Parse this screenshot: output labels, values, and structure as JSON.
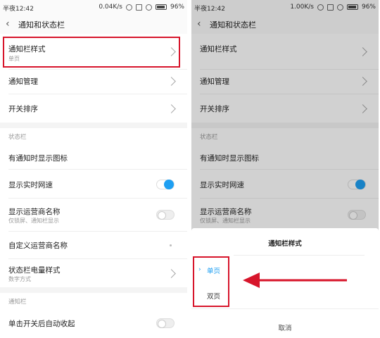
{
  "left": {
    "status": {
      "time": "半夜12:42",
      "speed": "0.04K/s",
      "battery": "96%"
    },
    "title": "通知和状态栏",
    "rows": {
      "notif_style": {
        "label": "通知栏样式",
        "sub": "单页"
      },
      "notif_manage": {
        "label": "通知管理"
      },
      "switch_order": {
        "label": "开关排序"
      },
      "statusbar_header": "状态栏",
      "show_icon": {
        "label": "有通知时显示图标"
      },
      "realtime_speed": {
        "label": "显示实时网速",
        "state": "on"
      },
      "carrier_name": {
        "label": "显示运营商名称",
        "sub": "仅锁屏、通知栏显示",
        "state": "off"
      },
      "custom_carrier": {
        "label": "自定义运营商名称"
      },
      "battery_style": {
        "label": "状态栏电量样式",
        "sub": "数字方式"
      },
      "notifbar_header": "通知栏",
      "auto_collapse": {
        "label": "单击开关后自动收起",
        "state": "off"
      }
    }
  },
  "right": {
    "status": {
      "time": "半夜12:42",
      "speed": "1.00K/s",
      "battery": "96%"
    },
    "title": "通知和状态栏",
    "rows": {
      "notif_style": {
        "label": "通知栏样式"
      },
      "notif_manage": {
        "label": "通知管理"
      },
      "switch_order": {
        "label": "开关排序"
      },
      "statusbar_header": "状态栏",
      "show_icon": {
        "label": "有通知时显示图标"
      },
      "realtime_speed": {
        "label": "显示实时网速"
      },
      "carrier_name": {
        "label": "显示运营商名称",
        "sub": "仅锁屏、通知栏显示"
      }
    },
    "sheet": {
      "title": "通知栏样式",
      "options": [
        "单页",
        "双页"
      ],
      "selected": "单页",
      "cancel": "取消"
    }
  },
  "colors": {
    "accent": "#1e9ff2",
    "highlight": "#d7152b"
  }
}
